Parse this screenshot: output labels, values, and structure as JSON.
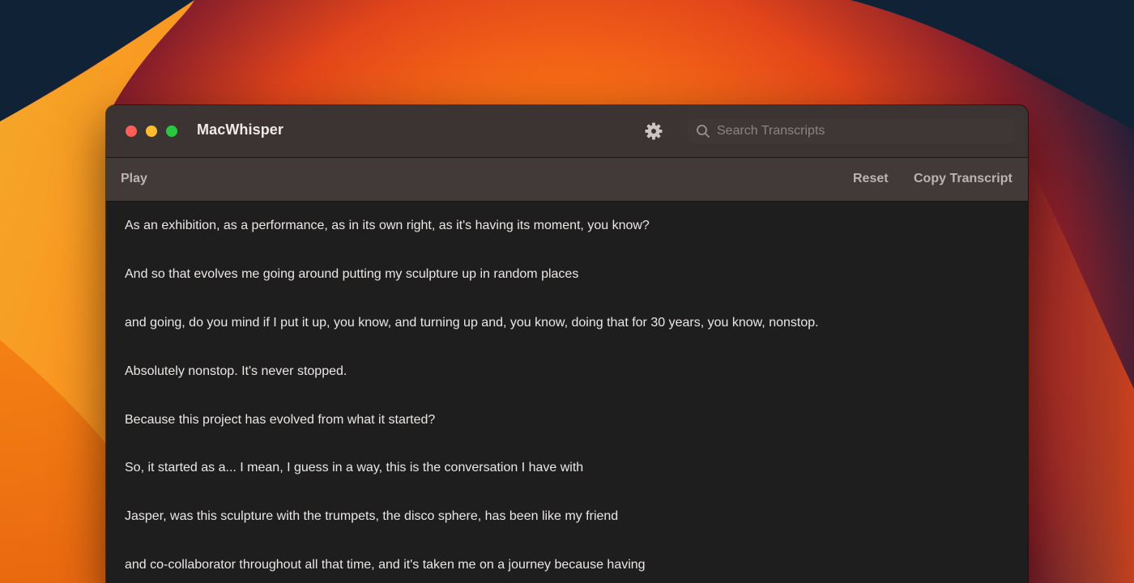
{
  "window": {
    "title": "MacWhisper",
    "controls": [
      "close",
      "minimize",
      "zoom"
    ]
  },
  "titlebar": {
    "settings_icon": "gear-icon",
    "search": {
      "icon": "search-icon",
      "value": "",
      "placeholder": "Search Transcripts"
    }
  },
  "toolbar": {
    "play_label": "Play",
    "reset_label": "Reset",
    "copy_label": "Copy Transcript"
  },
  "transcript": {
    "lines": [
      "As an exhibition, as a performance, as in its own right, as it's having its moment, you know?",
      "And so that evolves me going around putting my sculpture up in random places",
      "and going, do you mind if I put it up, you know, and turning up and, you know, doing that for 30 years, you know, nonstop.",
      "Absolutely nonstop. It's never stopped.",
      "Because this project has evolved from what it started?",
      "So, it started as a... I mean, I guess in a way, this is the conversation I have with",
      "Jasper, was this sculpture with the trumpets, the disco sphere, has been like my friend",
      "and co-collaborator throughout all that time, and it's taken me on a journey because having"
    ]
  },
  "colors": {
    "titlebar": "#3b3433",
    "toolbar": "#423a39",
    "content": "#1f1e1f",
    "text": "#ebe7e5",
    "close": "#ff5f57",
    "minimize": "#febc2e",
    "zoom": "#28c840"
  }
}
